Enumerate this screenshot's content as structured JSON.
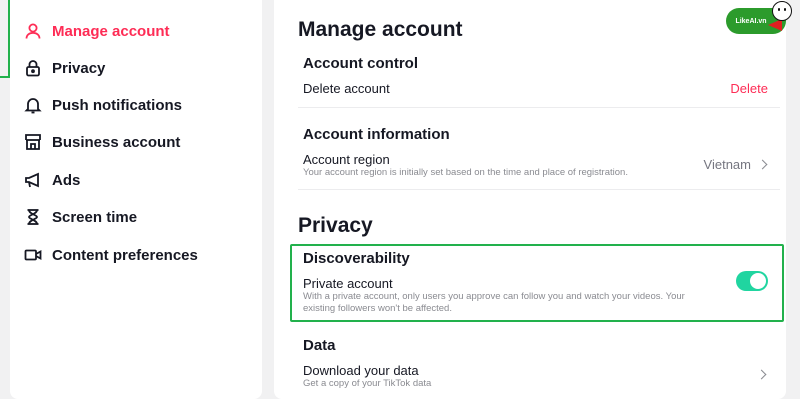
{
  "sidebar": {
    "items": [
      {
        "label": "Manage account",
        "icon": "user-icon",
        "active": true
      },
      {
        "label": "Privacy",
        "icon": "lock-icon",
        "active": false
      },
      {
        "label": "Push notifications",
        "icon": "bell-icon",
        "active": false
      },
      {
        "label": "Business account",
        "icon": "store-icon",
        "active": false
      },
      {
        "label": "Ads",
        "icon": "megaphone-icon",
        "active": false
      },
      {
        "label": "Screen time",
        "icon": "hourglass-icon",
        "active": false
      },
      {
        "label": "Content preferences",
        "icon": "video-camera-icon",
        "active": false
      }
    ]
  },
  "main": {
    "title": "Manage account",
    "account_control": {
      "heading": "Account control",
      "delete_label": "Delete account",
      "delete_action": "Delete"
    },
    "account_information": {
      "heading": "Account information",
      "region_label": "Account region",
      "region_desc": "Your account region is initially set based on the time and place of registration.",
      "region_value": "Vietnam"
    },
    "privacy": {
      "title": "Privacy",
      "discoverability": {
        "heading": "Discoverability",
        "private_label": "Private account",
        "private_desc": "With a private account, only users you approve can follow you and watch your videos. Your existing followers won't be affected.",
        "private_enabled": true
      }
    },
    "data": {
      "heading": "Data",
      "download_label": "Download your data",
      "download_desc": "Get a copy of your TikTok data"
    }
  },
  "logo": {
    "text": "LikeAI.vn"
  },
  "colors": {
    "accent": "#fe2c55",
    "toggle_on": "#20d5a0",
    "highlight": "#22b14c"
  }
}
